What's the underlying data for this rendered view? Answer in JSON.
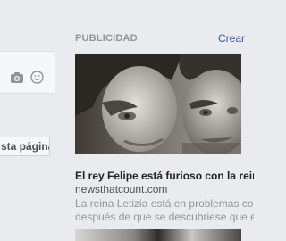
{
  "left_panel": {
    "page_button_label": "sta página",
    "icons": [
      "camera-icon",
      "emoji-icon"
    ]
  },
  "ad": {
    "section_label": "PUBLICIDAD",
    "create_link": "Crear",
    "title": "El rey Felipe está furioso con la reina Le",
    "domain": "newsthatcount.com",
    "description_line1": "La reina Letizia está en problemas con el",
    "description_line2": "después de que se descubriese que ell"
  },
  "colors": {
    "background": "#e9ebee",
    "link": "#365899",
    "muted": "#90949c",
    "title": "#1d2129"
  }
}
